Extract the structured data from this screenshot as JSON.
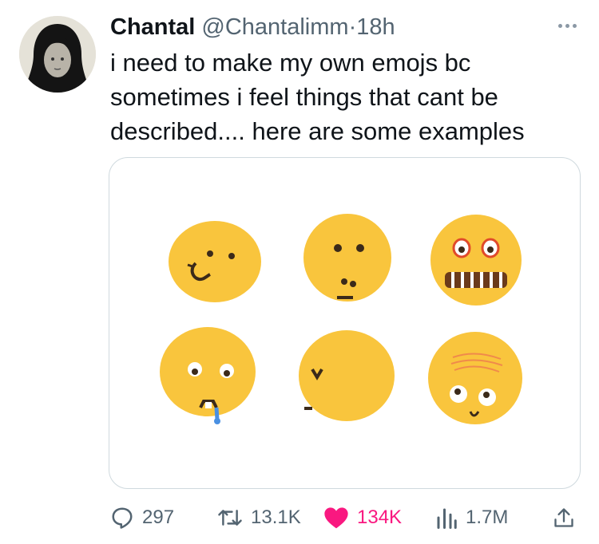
{
  "tweet": {
    "author_name": "Chantal",
    "handle": "@Chantalimm",
    "separator": "·",
    "time": "18h",
    "text_lines": [
      "i need to make my own emojs bc",
      "sometimes i feel things that cant be",
      "described.... here are some examples"
    ]
  },
  "actions": {
    "replies": "297",
    "retweets": "13.1K",
    "likes": "134K",
    "views": "1.7M"
  },
  "icons": {
    "more": "more-icon",
    "reply": "reply-icon",
    "retweet": "retweet-icon",
    "like": "heart-icon",
    "views": "views-icon",
    "share": "share-icon"
  },
  "colors": {
    "emoji_yellow": "#f9c53d",
    "like_pink": "#f91880",
    "muted": "#536471"
  }
}
